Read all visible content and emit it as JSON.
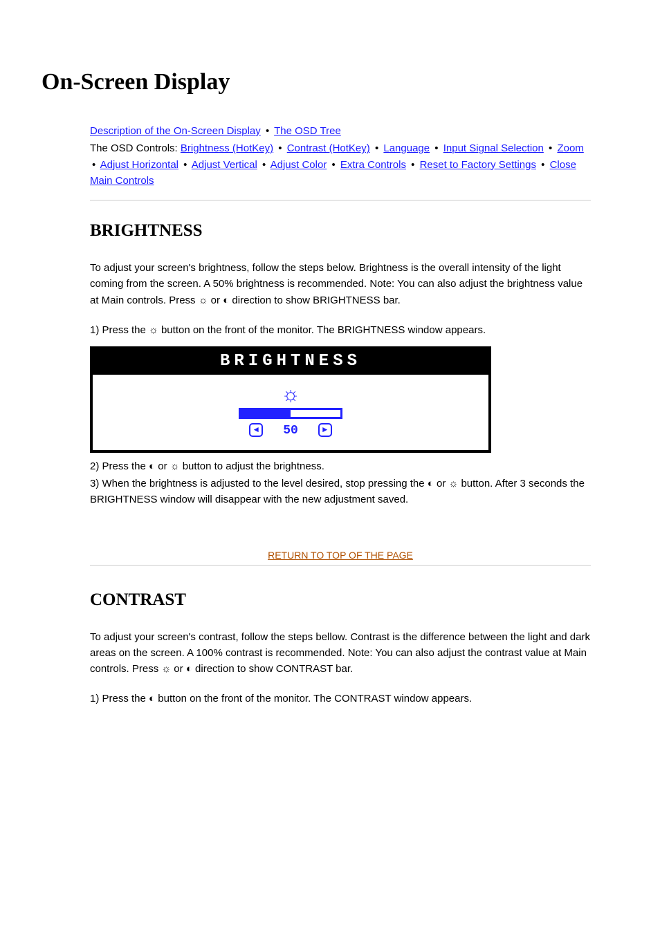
{
  "title": "On-Screen Display",
  "nav": {
    "intro": "Description of the On-Screen Display",
    "tree": "The OSD Tree",
    "controls_label": "The OSD Controls:",
    "controls": [
      "Brightness (HotKey)",
      "Contrast (HotKey)",
      "Language",
      "Input Signal Selection",
      "Zoom",
      "Adjust Horizontal",
      "Adjust Vertical",
      "Adjust Color",
      "Extra Controls",
      "Reset to Factory Settings",
      "Close Main Controls"
    ]
  },
  "brightness": {
    "heading": "BRIGHTNESS",
    "intro_prefix": "To adjust your screen's brightness, follow the steps below. Brightness is the overall intensity of the light coming from the screen. A 50% brightness is recommended. Note: You can also adjust the brightness value at Main controls. Press ",
    "intro_mid": " or ",
    "intro_suffix": " direction to show BRIGHTNESS bar.",
    "step1": "1) Press the ",
    "step1_end": " button on the front of the monitor. The BRIGHTNESS window appears.",
    "osd_title": "BRIGHTNESS",
    "osd_value": "50",
    "step2": "2) Press the ",
    "step2_mid": " or ",
    "step2_end": " button to adjust the brightness.",
    "step3": "3) When the brightness is adjusted to the level desired, stop pressing the ",
    "step3_mid": " or ",
    "step3_end": " button. After 3 seconds the BRIGHTNESS window will disappear with the new adjustment saved.",
    "return_link": "RETURN TO TOP OF THE PAGE"
  },
  "contrast": {
    "heading": "CONTRAST",
    "intro_prefix": "To adjust your screen's contrast, follow the steps bellow. Contrast is the difference between the light and dark areas on the screen. A 100% contrast is recommended. Note: You can also adjust the contrast value at Main controls. Press ",
    "intro_mid": " or ",
    "intro_suffix": " direction to show CONTRAST bar.",
    "step1": "1) Press the ",
    "step1_end": " button on the front of the monitor. The CONTRAST window appears."
  },
  "icons": {
    "sun": "☼",
    "contrast": "◐",
    "left": "◄",
    "right": "►"
  }
}
